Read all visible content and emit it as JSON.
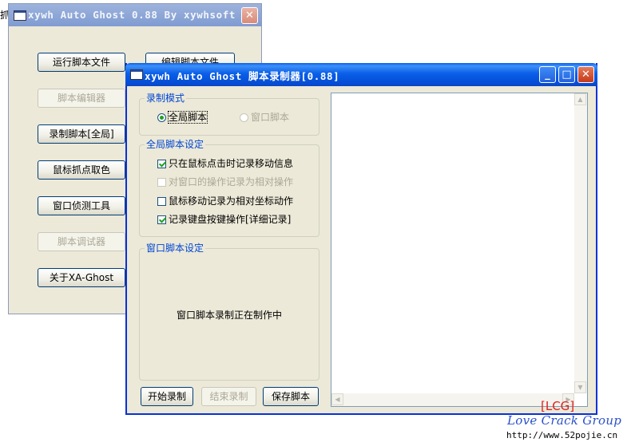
{
  "stray_text": "抓",
  "back_window": {
    "title": "xywh Auto Ghost 0.88 By xywhsoft",
    "buttons": {
      "run_script": "运行脚本文件",
      "edit_script": "编辑脚本文件",
      "script_editor": "脚本编辑器",
      "record_global": "录制脚本[全局]",
      "mouse_pick_color": "鼠标抓点取色",
      "window_detect": "窗口侦测工具",
      "script_debugger": "脚本调试器",
      "about": "关于XA-Ghost"
    }
  },
  "front_window": {
    "title": "xywh Auto Ghost 脚本录制器[0.88]",
    "record_mode": {
      "title": "录制模式",
      "options": [
        {
          "label": "全局脚本",
          "selected": true,
          "enabled": true
        },
        {
          "label": "窗口脚本",
          "selected": false,
          "enabled": false
        }
      ]
    },
    "global_settings": {
      "title": "全局脚本设定",
      "options": [
        {
          "label": "只在鼠标点击时记录移动信息",
          "checked": true,
          "enabled": true
        },
        {
          "label": "对窗口的操作记录为相对操作",
          "checked": false,
          "enabled": false
        },
        {
          "label": "鼠标移动记录为相对坐标动作",
          "checked": false,
          "enabled": true
        },
        {
          "label": "记录键盘按键操作[详细记录]",
          "checked": true,
          "enabled": true
        }
      ]
    },
    "window_settings": {
      "title": "窗口脚本设定",
      "message": "窗口脚本录制正在制作中"
    },
    "buttons": {
      "start": "开始录制",
      "stop": "结束录制",
      "save": "保存脚本"
    }
  },
  "watermark": {
    "tag": "[LCG]",
    "group": "Love Crack Group",
    "url": "http://www.52pojie.cn"
  },
  "icons": [
    "app-window-icon",
    "minimize-icon",
    "maximize-icon",
    "close-icon"
  ],
  "colors": {
    "titlebar": "#0a5fe8",
    "close_button": "#c4391b",
    "group_title": "#0046d5",
    "dialog_bg": "#ECE9D8"
  }
}
